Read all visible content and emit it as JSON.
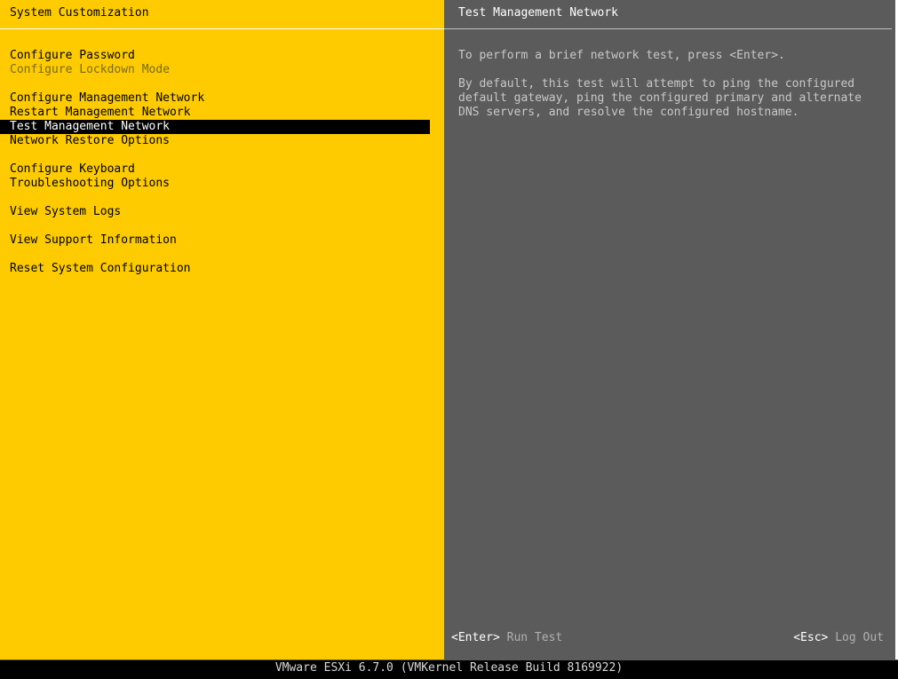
{
  "left": {
    "title": "System Customization",
    "menu": [
      {
        "label": "Configure Password"
      },
      {
        "label": "Configure Lockdown Mode"
      },
      {
        "label": "Configure Management Network"
      },
      {
        "label": "Restart Management Network"
      },
      {
        "label": "Test Management Network"
      },
      {
        "label": "Network Restore Options"
      },
      {
        "label": "Configure Keyboard"
      },
      {
        "label": "Troubleshooting Options"
      },
      {
        "label": "View System Logs"
      },
      {
        "label": "View Support Information"
      },
      {
        "label": "Reset System Configuration"
      }
    ],
    "selected_item": "Test Management Network",
    "disabled_item": "Configure Lockdown Mode"
  },
  "right": {
    "title": "Test Management Network",
    "paragraph1": "To perform a brief network test, press <Enter>.",
    "paragraph2_lines": [
      "By default, this test will attempt to ping the configured",
      "default gateway, ping the configured primary and alternate",
      "DNS servers, and resolve the configured hostname."
    ],
    "hint_enter_key": "<Enter>",
    "hint_enter_action": "Run Test",
    "hint_esc_key": "<Esc>",
    "hint_esc_action": "Log Out"
  },
  "status_bar": {
    "text": "VMware ESXi 6.7.0 (VMKernel Release Build 8169922)"
  },
  "colors": {
    "left_bg": "#fdcb00",
    "right_bg": "#5b5b5b",
    "selected_bg": "#000000",
    "selected_fg": "#ffffff"
  }
}
